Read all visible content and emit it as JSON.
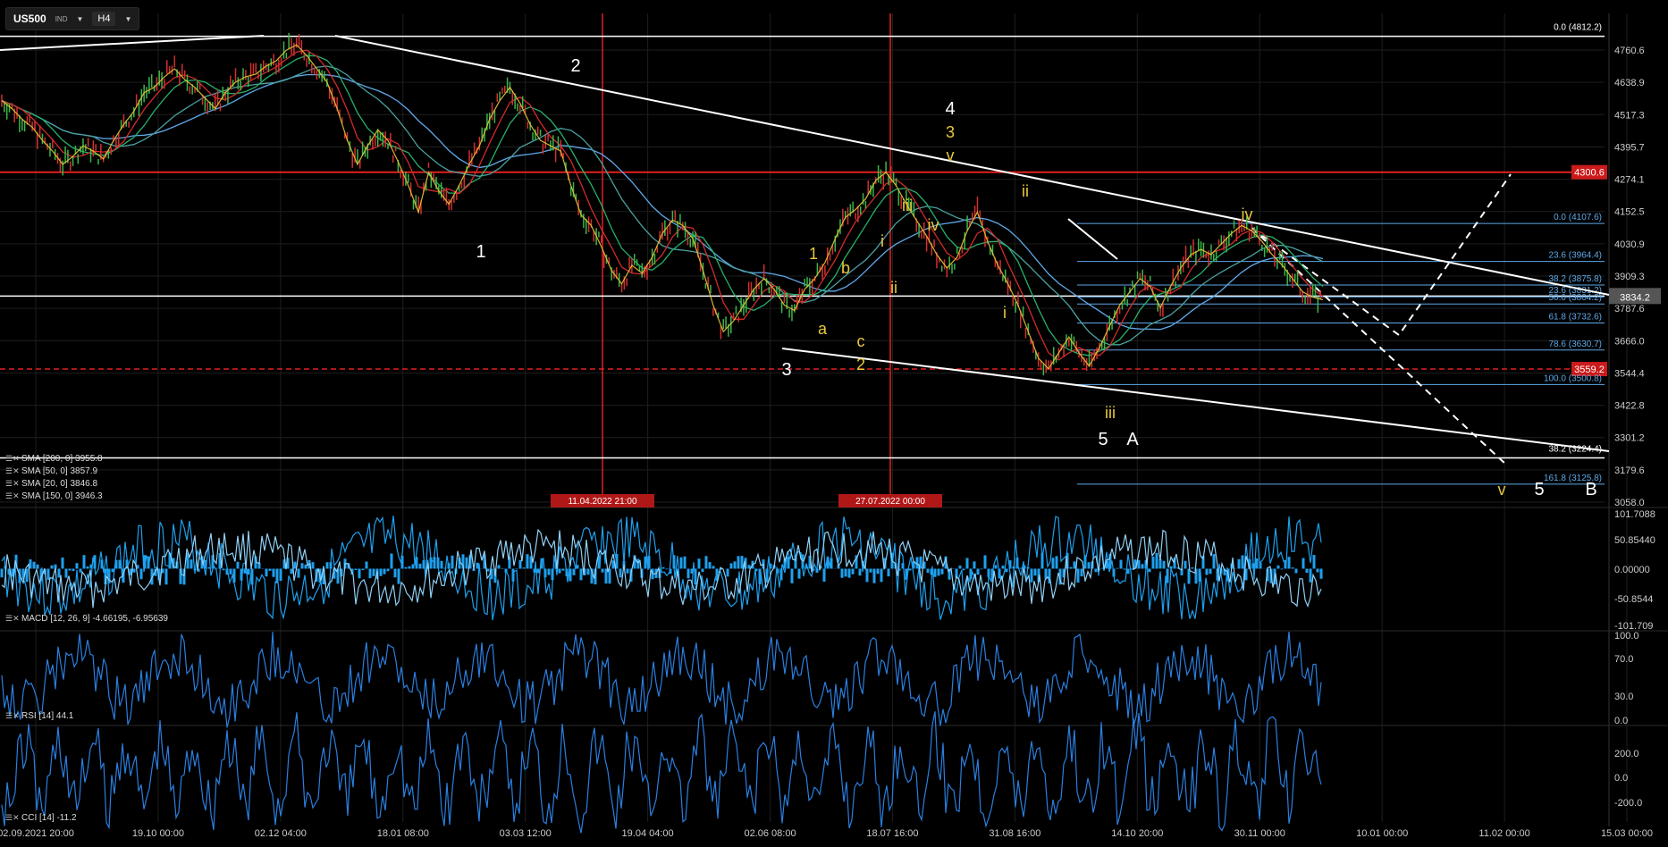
{
  "toolbar": {
    "symbol": "US500",
    "type": "IND",
    "timeframe": "H4"
  },
  "colors": {
    "bg": "#000000",
    "grid": "#1e1e1e",
    "white": "#ffffff",
    "red": "#e02020",
    "fib": "#5fa8e8",
    "yellow": "#e8c83a",
    "macd": "#1ea0ee",
    "osc": "#2a7fe0"
  },
  "chart_data": [
    {
      "type": "line",
      "title": "US500",
      "y_ticks": [
        "4760.6",
        "4638.9",
        "4517.3",
        "4395.7",
        "4274.1",
        "4152.5",
        "4030.9",
        "3909.3",
        "3787.6",
        "3666.0",
        "3544.4",
        "3422.8",
        "3301.2",
        "3179.6",
        "3058.0"
      ],
      "x_ticks": [
        "02.09.2021 20:00",
        "19.10 00:00",
        "02.12 04:00",
        "18.01 08:00",
        "03.03 12:00",
        "19.04 04:00",
        "02.06 08:00",
        "18.07 16:00",
        "31.08 16:00",
        "14.10 20:00",
        "30.11 00:00",
        "10.01 00:00",
        "11.02 00:00",
        "15.03 00:00"
      ],
      "ylim": [
        3058.0,
        4812.2
      ],
      "current_price": "3834.2",
      "levels": [
        {
          "label": "0.0 (4812.2)",
          "value": 4812.2,
          "color": "white"
        },
        {
          "label": "4300.6",
          "value": 4300.6,
          "color": "red"
        },
        {
          "label": "3834.2",
          "value": 3834.2,
          "color": "white"
        },
        {
          "label": "3559.2",
          "value": 3559.2,
          "color": "red-dashed"
        },
        {
          "label": "38.2 (3224.4)",
          "value": 3224.4,
          "color": "white"
        }
      ],
      "fib_levels": [
        {
          "label": "0.0 (4107.6)",
          "value": 4107.6
        },
        {
          "label": "23.6 (3964.4)",
          "value": 3964.4
        },
        {
          "label": "38.2 (3875.8)",
          "value": 3875.8
        },
        {
          "label": "23.6 (3831.2)",
          "value": 3831.2
        },
        {
          "label": "50.0 (3804.2)",
          "value": 3804.2
        },
        {
          "label": "61.8 (3732.6)",
          "value": 3732.6
        },
        {
          "label": "78.6 (3630.7)",
          "value": 3630.7
        },
        {
          "label": "100.0 (3500.8)",
          "value": 3500.8
        },
        {
          "label": "161.8 (3125.8)",
          "value": 3125.8
        }
      ],
      "vertical_markers": [
        "11.04.2022 21:00",
        "27.07.2022 00:00"
      ],
      "price_path": [
        4570,
        4540,
        4500,
        4470,
        4420,
        4380,
        4330,
        4360,
        4400,
        4380,
        4350,
        4420,
        4480,
        4530,
        4600,
        4620,
        4660,
        4690,
        4650,
        4620,
        4580,
        4540,
        4600,
        4640,
        4660,
        4670,
        4700,
        4720,
        4760,
        4780,
        4740,
        4690,
        4640,
        4540,
        4420,
        4330,
        4400,
        4460,
        4420,
        4340,
        4250,
        4150,
        4300,
        4230,
        4180,
        4250,
        4330,
        4400,
        4500,
        4570,
        4620,
        4560,
        4480,
        4420,
        4400,
        4380,
        4250,
        4140,
        4100,
        4020,
        3930,
        3880,
        3950,
        3920,
        3980,
        4070,
        4120,
        4100,
        4050,
        3930,
        3800,
        3700,
        3740,
        3800,
        3860,
        3900,
        3860,
        3800,
        3780,
        3860,
        3900,
        3960,
        4050,
        4130,
        4160,
        4200,
        4270,
        4300,
        4250,
        4180,
        4120,
        4060,
        3990,
        3940,
        3980,
        4080,
        4150,
        4040,
        3950,
        3880,
        3800,
        3700,
        3600,
        3560,
        3620,
        3680,
        3620,
        3570,
        3640,
        3720,
        3800,
        3850,
        3900,
        3870,
        3790,
        3870,
        3940,
        3990,
        4010,
        3990,
        4030,
        4070,
        4100,
        4080,
        4040,
        3990,
        3950,
        3900,
        3850,
        3830,
        3820
      ],
      "wave_labels": [
        {
          "text": "1",
          "color": "white"
        },
        {
          "text": "2",
          "color": "white"
        },
        {
          "text": "3",
          "color": "white"
        },
        {
          "text": "4",
          "color": "white"
        },
        {
          "text": "3",
          "color": "yellow"
        },
        {
          "text": "v",
          "color": "yellow"
        },
        {
          "text": "1",
          "color": "yellow"
        },
        {
          "text": "a",
          "color": "yellow"
        },
        {
          "text": "b",
          "color": "yellow"
        },
        {
          "text": "c",
          "color": "yellow"
        },
        {
          "text": "2",
          "color": "yellow"
        },
        {
          "text": "i",
          "color": "yellow"
        },
        {
          "text": "ii",
          "color": "yellow"
        },
        {
          "text": "iii",
          "color": "yellow"
        },
        {
          "text": "iv",
          "color": "yellow"
        },
        {
          "text": "ii",
          "color": "yellow"
        },
        {
          "text": "i",
          "color": "yellow"
        },
        {
          "text": "iii",
          "color": "yellow"
        },
        {
          "text": "5",
          "color": "white"
        },
        {
          "text": "A",
          "color": "white"
        },
        {
          "text": "iv",
          "color": "yellow"
        },
        {
          "text": "v",
          "color": "yellow"
        },
        {
          "text": "5",
          "color": "white"
        },
        {
          "text": "B",
          "color": "white"
        }
      ],
      "indicators": [
        {
          "label": "SMA [200, 0] 3955.8",
          "color": "#5fa8e8"
        },
        {
          "label": "SMA [50, 0] 3857.9",
          "color": "#27b06a"
        },
        {
          "label": "SMA [20, 0] 3846.8",
          "color": "#d22b2b"
        },
        {
          "label": "SMA [150, 0] 3946.3",
          "color": "#4aa0a0"
        }
      ]
    },
    {
      "type": "area",
      "title": "MACD [12, 26, 9] -4.66195, -6.95639",
      "y_ticks": [
        "101.7088",
        "50.85440",
        "0.00000",
        "-50.8544",
        "-101.709"
      ],
      "ylim": [
        -101.709,
        101.7088
      ]
    },
    {
      "type": "line",
      "title": "RSI [14] 44.1",
      "y_ticks": [
        "100.0",
        "70.0",
        "30.0",
        "0.0"
      ],
      "ylim": [
        0,
        100
      ]
    },
    {
      "type": "line",
      "title": "CCI [14] -11.2",
      "y_ticks": [
        "200.0",
        "0.0",
        "-200.0"
      ],
      "ylim": [
        -300,
        300
      ]
    }
  ]
}
